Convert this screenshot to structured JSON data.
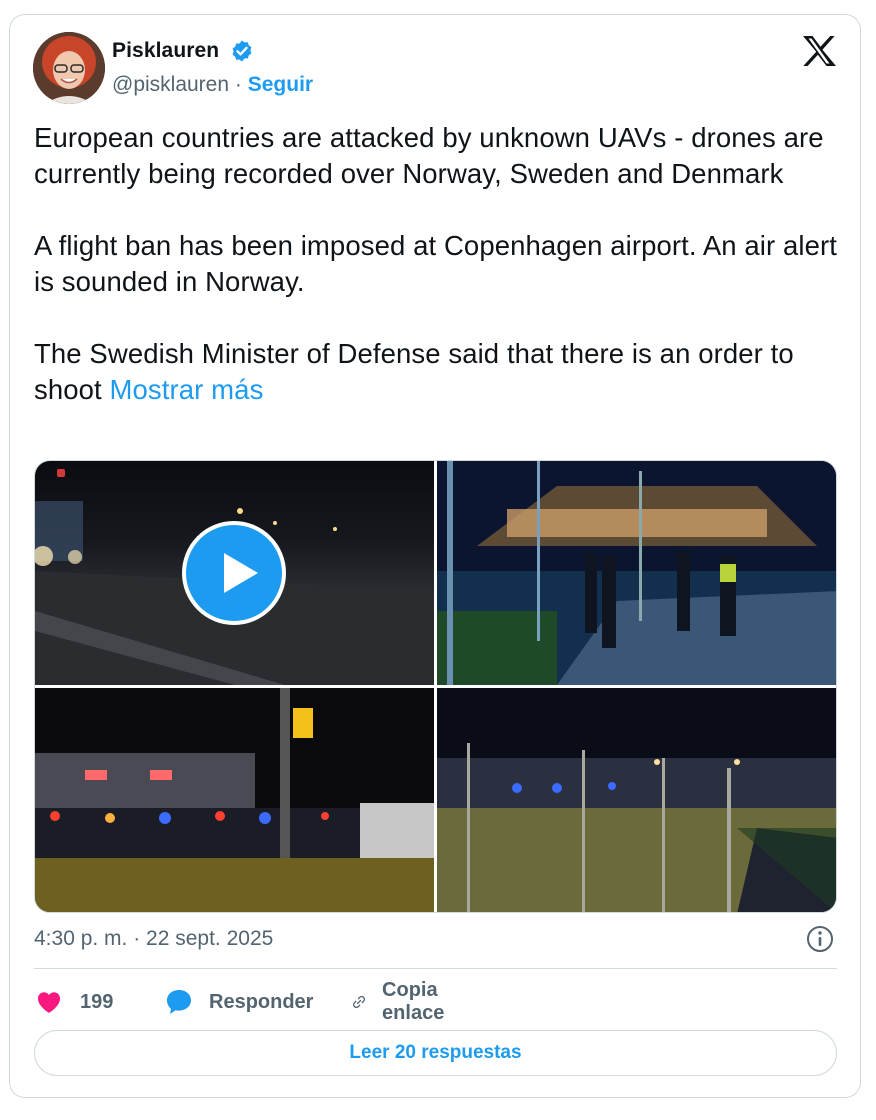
{
  "author": {
    "name": "Pisklauren",
    "handle": "@pisklauren",
    "separator": "·",
    "follow_label": "Seguir"
  },
  "tweet": {
    "paragraphs": [
      "European countries are attacked by unknown UAVs - drones are currently being recorded over Norway, Sweden and Denmark",
      "A flight ban has been imposed at Copenhagen airport. An air alert is sounded in Norway.",
      "The Swedish Minister of Defense said that there is an order to shoot"
    ],
    "show_more": "Mostrar más"
  },
  "media": {
    "tiles": [
      "video-night-road",
      "police-at-airport",
      "police-lights-building",
      "fence-police-cars"
    ],
    "video_badge_icon": "play-icon"
  },
  "meta": {
    "timestamp": "4:30 p. m. · 22 sept. 2025"
  },
  "actions": {
    "likes": "199",
    "reply_label": "Responder",
    "copy_label": "Copia enlace"
  },
  "footer": {
    "read_replies": "Leer 20 respuestas"
  },
  "colors": {
    "accent": "#1d9bf0",
    "like": "#f91880",
    "muted": "#536471",
    "border": "#cfd9de"
  }
}
